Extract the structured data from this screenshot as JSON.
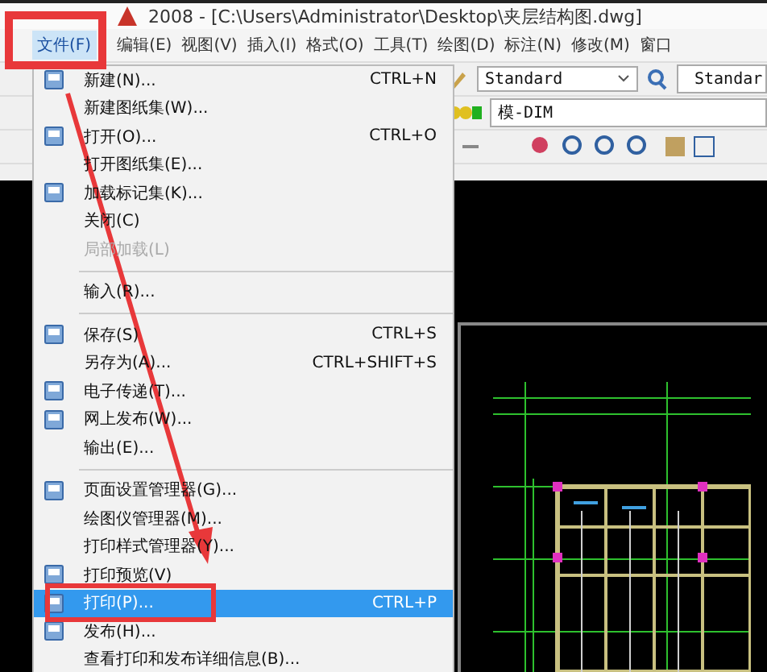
{
  "window": {
    "title": "2008 - [C:\\Users\\Administrator\\Desktop\\夹层结构图.dwg]"
  },
  "menu_bar": [
    {
      "label": "文件(F)",
      "selected": true
    },
    {
      "label": "编辑(E)",
      "selected": false
    },
    {
      "label": "视图(V)",
      "selected": false
    },
    {
      "label": "插入(I)",
      "selected": false
    },
    {
      "label": "格式(O)",
      "selected": false
    },
    {
      "label": "工具(T)",
      "selected": false
    },
    {
      "label": "绘图(D)",
      "selected": false
    },
    {
      "label": "标注(N)",
      "selected": false
    },
    {
      "label": "修改(M)",
      "selected": false
    },
    {
      "label": "窗口",
      "selected": false
    }
  ],
  "toolbar": {
    "text_style": "Standard",
    "dim_style": "Standar",
    "layer": "模-DIM"
  },
  "file_menu": [
    {
      "kind": "item",
      "label": "新建(N)...",
      "shortcut": "CTRL+N",
      "icon": true,
      "disabled": false,
      "selected": false
    },
    {
      "kind": "item",
      "label": "新建图纸集(W)...",
      "icon": false,
      "disabled": false,
      "selected": false
    },
    {
      "kind": "item",
      "label": "打开(O)...",
      "shortcut": "CTRL+O",
      "icon": true,
      "disabled": false,
      "selected": false
    },
    {
      "kind": "item",
      "label": "打开图纸集(E)...",
      "icon": false,
      "disabled": false,
      "selected": false
    },
    {
      "kind": "item",
      "label": "加载标记集(K)...",
      "icon": true,
      "disabled": false,
      "selected": false
    },
    {
      "kind": "item",
      "label": "关闭(C)",
      "icon": false,
      "disabled": false,
      "selected": false
    },
    {
      "kind": "item",
      "label": "局部加载(L)",
      "icon": false,
      "disabled": true,
      "selected": false
    },
    {
      "kind": "separator"
    },
    {
      "kind": "item",
      "label": "输入(R)...",
      "icon": false,
      "disabled": false,
      "selected": false
    },
    {
      "kind": "separator"
    },
    {
      "kind": "item",
      "label": "保存(S)",
      "shortcut": "CTRL+S",
      "icon": true,
      "disabled": false,
      "selected": false
    },
    {
      "kind": "item",
      "label": "另存为(A)...",
      "shortcut": "CTRL+SHIFT+S",
      "icon": false,
      "disabled": false,
      "selected": false
    },
    {
      "kind": "item",
      "label": "电子传递(T)...",
      "icon": true,
      "disabled": false,
      "selected": false
    },
    {
      "kind": "item",
      "label": "网上发布(W)...",
      "icon": true,
      "disabled": false,
      "selected": false
    },
    {
      "kind": "item",
      "label": "输出(E)...",
      "icon": false,
      "disabled": false,
      "selected": false
    },
    {
      "kind": "separator"
    },
    {
      "kind": "item",
      "label": "页面设置管理器(G)...",
      "icon": true,
      "disabled": false,
      "selected": false
    },
    {
      "kind": "item",
      "label": "绘图仪管理器(M)...",
      "icon": false,
      "disabled": false,
      "selected": false
    },
    {
      "kind": "item",
      "label": "打印样式管理器(Y)...",
      "icon": false,
      "disabled": false,
      "selected": false
    },
    {
      "kind": "item",
      "label": "打印预览(V)",
      "icon": true,
      "disabled": false,
      "selected": false
    },
    {
      "kind": "item",
      "label": "打印(P)...",
      "shortcut": "CTRL+P",
      "icon": true,
      "disabled": false,
      "selected": true
    },
    {
      "kind": "item",
      "label": "发布(H)...",
      "icon": true,
      "disabled": false,
      "selected": false
    },
    {
      "kind": "item",
      "label": "查看打印和发布详细信息(B)...",
      "icon": false,
      "disabled": false,
      "selected": false
    }
  ]
}
